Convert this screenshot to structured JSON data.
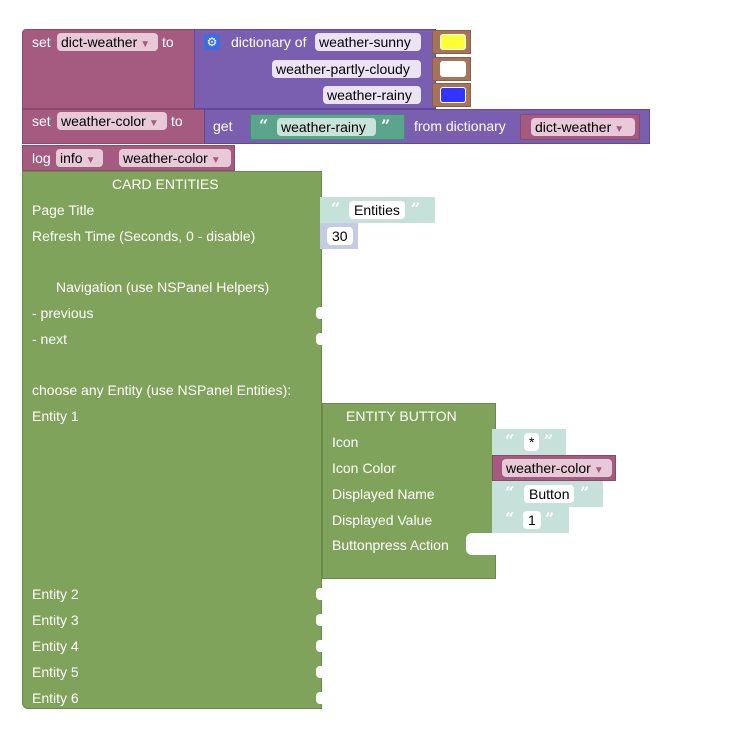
{
  "set_dict": {
    "set_label": "set",
    "var_name": "dict-weather",
    "to_label": "to",
    "dict_label": "dictionary of",
    "entries": [
      {
        "key": "weather-sunny",
        "color": "#ffff33"
      },
      {
        "key": "weather-partly-cloudy",
        "color": "#ffffff"
      },
      {
        "key": "weather-rainy",
        "color": "#3333ff"
      }
    ]
  },
  "set_color": {
    "set_label": "set",
    "var_name": "weather-color",
    "to_label": "to",
    "get_label": "get",
    "get_key": "weather-rainy",
    "from_label": "from dictionary",
    "dict_var": "dict-weather"
  },
  "log": {
    "label": "log",
    "level": "info",
    "var_name": "weather-color"
  },
  "card": {
    "title": "CARD ENTITIES",
    "page_title_label": "Page Title",
    "page_title_value": "Entities",
    "refresh_label": "Refresh Time (Seconds, 0 - disable)",
    "refresh_value": "30",
    "nav_label": "Navigation (use NSPanel Helpers)",
    "prev_label": "- previous",
    "next_label": "- next",
    "choose_label": "choose any Entity (use NSPanel Entities):",
    "entities": [
      "Entity 1",
      "Entity 2",
      "Entity 3",
      "Entity 4",
      "Entity 5",
      "Entity 6"
    ]
  },
  "entity_button": {
    "title": "ENTITY BUTTON",
    "icon_label": "Icon",
    "icon_value": "*",
    "icon_color_label": "Icon Color",
    "icon_color_var": "weather-color",
    "name_label": "Displayed Name",
    "name_value": "Button",
    "value_label": "Displayed Value",
    "value_value": "1",
    "action_label": "Buttonpress Action"
  },
  "colors": {
    "variable": "#a55b80",
    "dictionary": "#7a5fb0",
    "text": "#5ba58c",
    "card": "#7fa35a"
  }
}
